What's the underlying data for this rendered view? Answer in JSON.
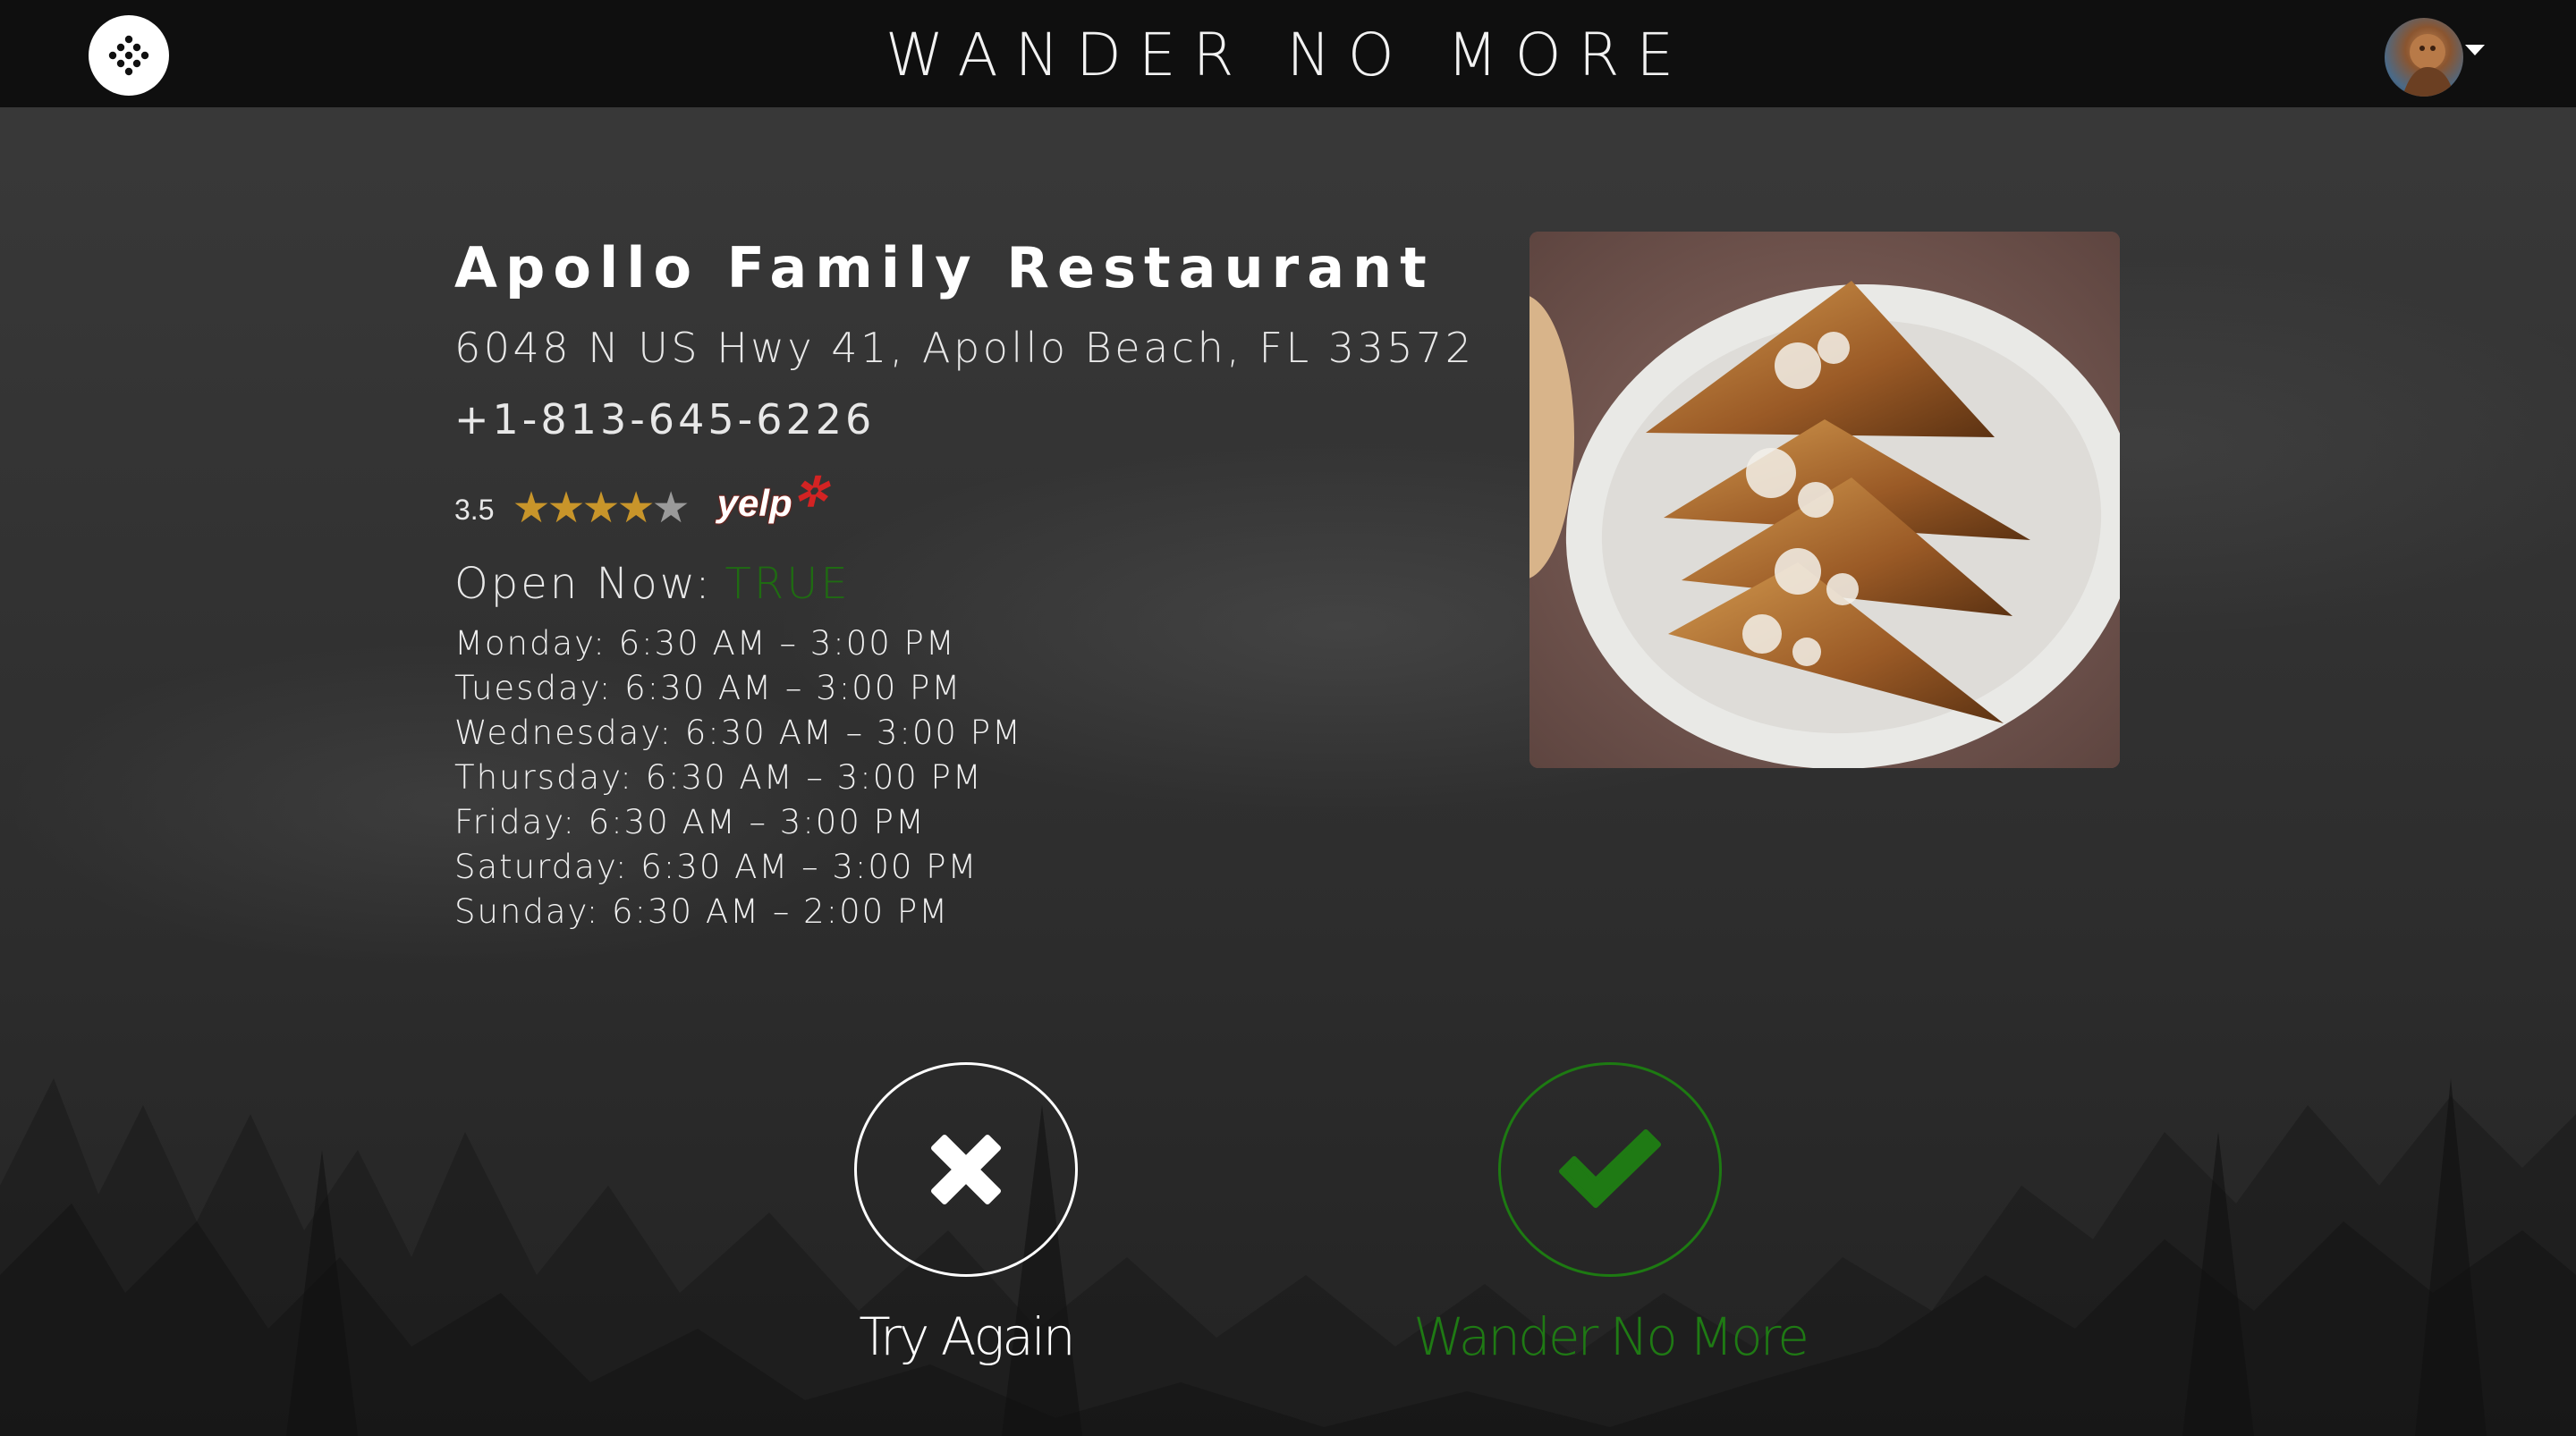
{
  "header": {
    "title": "WANDER NO MORE",
    "menu_icon": "dots-grid-icon",
    "avatar_icon": "user-avatar",
    "dropdown_icon": "caret-down-icon"
  },
  "restaurant": {
    "name": "Apollo Family Restaurant",
    "address": "6048 N US Hwy 41, Apollo Beach, FL 33572",
    "phone": "+1-813-645-6226",
    "rating": "3.5",
    "rating_value": 3.5,
    "rating_max": 5,
    "rating_source": "yelp",
    "open_now_label": "Open Now:",
    "open_now_value": "TRUE",
    "hours": [
      "Monday: 6:30 AM – 3:00 PM",
      "Tuesday: 6:30 AM – 3:00 PM",
      "Wednesday: 6:30 AM – 3:00 PM",
      "Thursday: 6:30 AM – 3:00 PM",
      "Friday: 6:30 AM – 3:00 PM",
      "Saturday: 6:30 AM – 3:00 PM",
      "Sunday: 6:30 AM – 2:00 PM"
    ]
  },
  "actions": {
    "try_again_label": "Try Again",
    "wander_no_more_label": "Wander No More"
  },
  "colors": {
    "header_bg": "#0f0f0f",
    "accent_green": "#1f7a14",
    "star_gold": "#c8952a",
    "yelp_red": "#d32323"
  }
}
